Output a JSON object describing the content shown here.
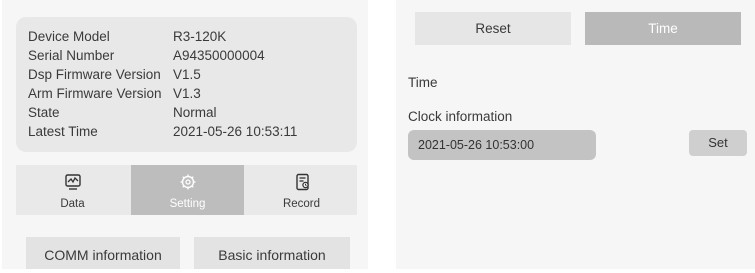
{
  "device_info": {
    "rows": [
      {
        "label": "Device Model",
        "value": "R3-120K"
      },
      {
        "label": "Serial Number",
        "value": "A94350000004"
      },
      {
        "label": "Dsp Firmware Version",
        "value": "V1.5"
      },
      {
        "label": "Arm Firmware Version",
        "value": "V1.3"
      },
      {
        "label": "State",
        "value": "Normal"
      },
      {
        "label": "Latest Time",
        "value": "2021-05-26 10:53:11"
      }
    ]
  },
  "nav": {
    "items": [
      {
        "label": "Data",
        "icon": "chart-monitor-icon"
      },
      {
        "label": "Setting",
        "icon": "gear-icon"
      },
      {
        "label": "Record",
        "icon": "record-document-icon"
      }
    ],
    "active": "Setting"
  },
  "bottom_buttons": {
    "comm": "COMM information",
    "basic": "Basic information"
  },
  "right": {
    "reset_label": "Reset",
    "time_label": "Time",
    "section_title": "Time",
    "clock_title": "Clock information",
    "clock_value": "2021-05-26 10:53:00",
    "set_label": "Set"
  },
  "colors": {
    "panel_bg": "#f6f6f6",
    "card_bg": "#e8e8e8",
    "active_tab": "#bdbdbd",
    "time_button": "#b9b9b9"
  }
}
